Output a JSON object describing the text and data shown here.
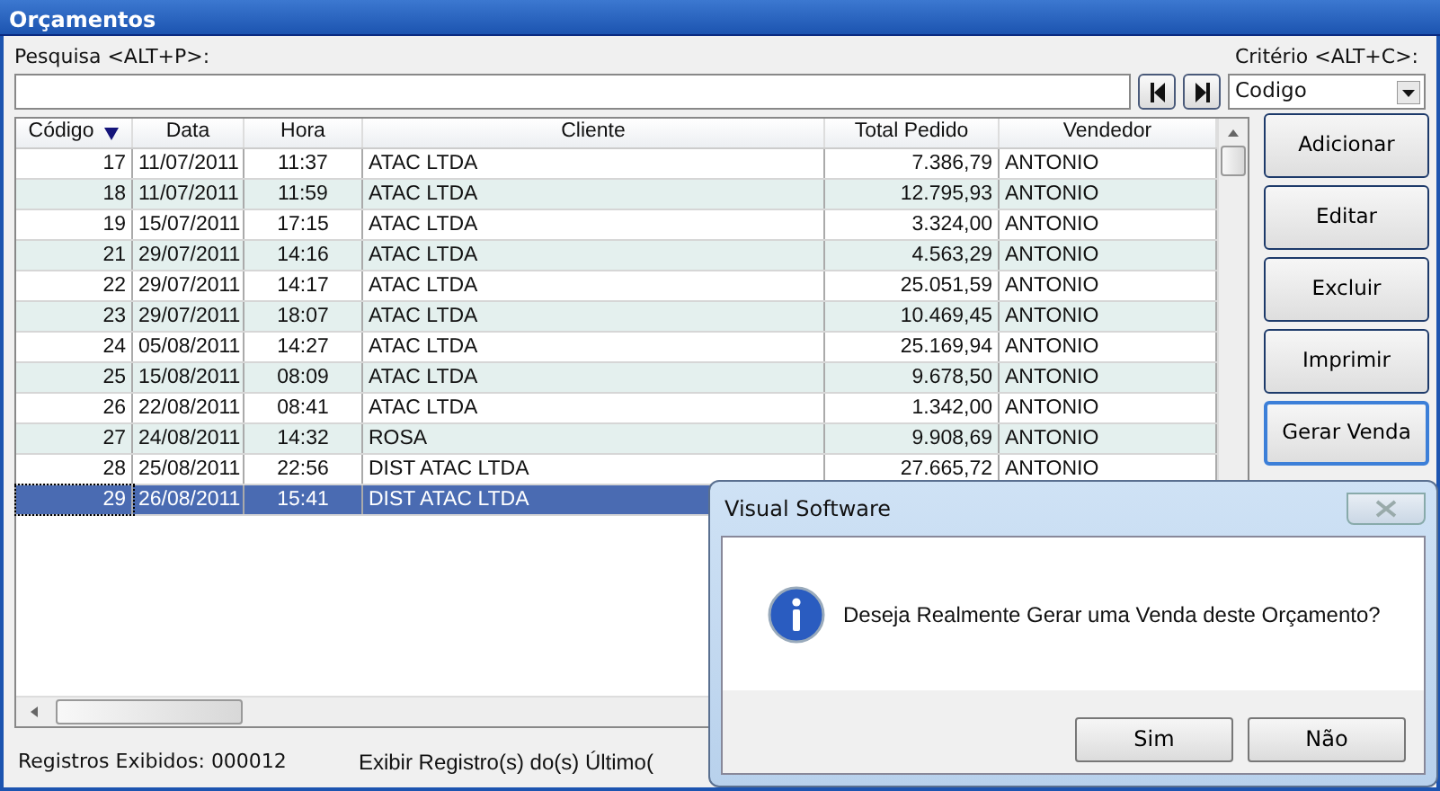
{
  "window": {
    "title": "Orçamentos"
  },
  "search": {
    "label": "Pesquisa <ALT+P>:"
  },
  "criteria": {
    "label": "Critério <ALT+C>:",
    "value": "Codigo"
  },
  "table": {
    "columns": [
      {
        "label": "Código",
        "sorted": true
      },
      {
        "label": "Data",
        "sorted": false
      },
      {
        "label": "Hora",
        "sorted": false
      },
      {
        "label": "Cliente",
        "sorted": false
      },
      {
        "label": "Total Pedido",
        "sorted": false
      },
      {
        "label": "Vendedor",
        "sorted": false
      }
    ],
    "rows": [
      {
        "selected": false,
        "cells": [
          "17",
          "11/07/2011",
          "11:37",
          "ATAC LTDA",
          "7.386,79",
          "ANTONIO"
        ]
      },
      {
        "selected": false,
        "cells": [
          "18",
          "11/07/2011",
          "11:59",
          "ATAC LTDA",
          "12.795,93",
          "ANTONIO"
        ]
      },
      {
        "selected": false,
        "cells": [
          "19",
          "15/07/2011",
          "17:15",
          "ATAC LTDA",
          "3.324,00",
          "ANTONIO"
        ]
      },
      {
        "selected": false,
        "cells": [
          "21",
          "29/07/2011",
          "14:16",
          "ATAC LTDA",
          "4.563,29",
          "ANTONIO"
        ]
      },
      {
        "selected": false,
        "cells": [
          "22",
          "29/07/2011",
          "14:17",
          "ATAC LTDA",
          "25.051,59",
          "ANTONIO"
        ]
      },
      {
        "selected": false,
        "cells": [
          "23",
          "29/07/2011",
          "18:07",
          "ATAC LTDA",
          "10.469,45",
          "ANTONIO"
        ]
      },
      {
        "selected": false,
        "cells": [
          "24",
          "05/08/2011",
          "14:27",
          "ATAC LTDA",
          "25.169,94",
          "ANTONIO"
        ]
      },
      {
        "selected": false,
        "cells": [
          "25",
          "15/08/2011",
          "08:09",
          "ATAC LTDA",
          "9.678,50",
          "ANTONIO"
        ]
      },
      {
        "selected": false,
        "cells": [
          "26",
          "22/08/2011",
          "08:41",
          "ATAC LTDA",
          "1.342,00",
          "ANTONIO"
        ]
      },
      {
        "selected": false,
        "cells": [
          "27",
          "24/08/2011",
          "14:32",
          "ROSA",
          "9.908,69",
          "ANTONIO"
        ]
      },
      {
        "selected": false,
        "cells": [
          "28",
          "25/08/2011",
          "22:56",
          "DIST ATAC LTDA",
          "27.665,72",
          "ANTONIO"
        ]
      },
      {
        "selected": true,
        "cells": [
          "29",
          "26/08/2011",
          "15:41",
          "DIST ATAC LTDA"
        ]
      }
    ]
  },
  "actions": [
    {
      "label": "Adicionar",
      "focused": false
    },
    {
      "label": "Editar",
      "focused": false
    },
    {
      "label": "Excluir",
      "focused": false
    },
    {
      "label": "Imprimir",
      "focused": false
    },
    {
      "label": "Gerar Venda",
      "focused": true
    }
  ],
  "status_bar": {
    "records": "Registros Exibidos: 000012",
    "filter": "Exibir Registro(s) do(s) Último("
  },
  "dialog": {
    "title": "Visual Software",
    "message": "Deseja Realmente Gerar uma Venda deste Orçamento?",
    "buttons": [
      "Sim",
      "Não"
    ]
  }
}
